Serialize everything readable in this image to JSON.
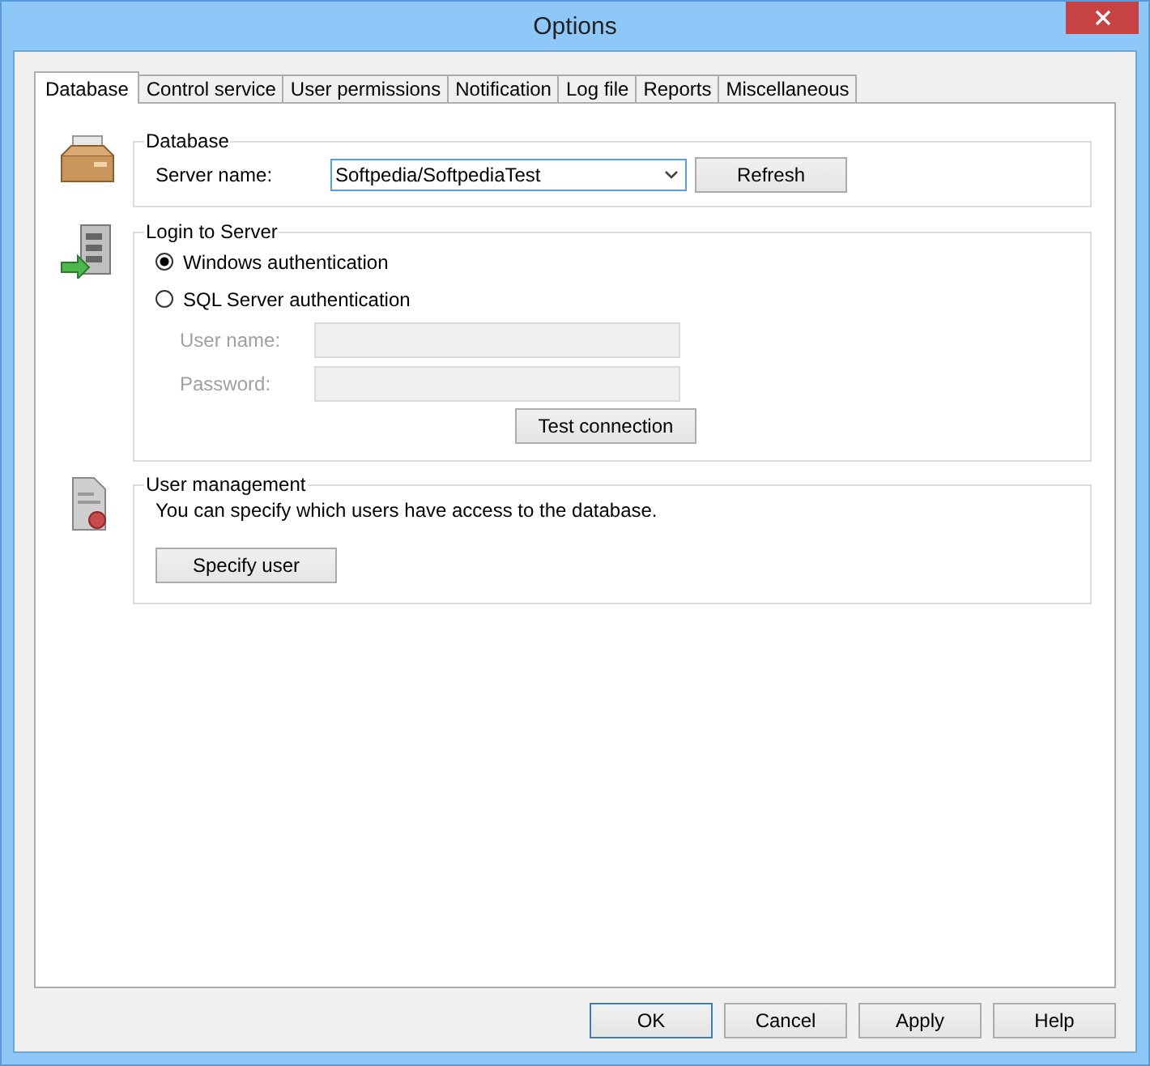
{
  "window": {
    "title": "Options"
  },
  "tabs": [
    {
      "label": "Database",
      "selected": true
    },
    {
      "label": "Control service",
      "selected": false
    },
    {
      "label": "User permissions",
      "selected": false
    },
    {
      "label": "Notification",
      "selected": false
    },
    {
      "label": "Log file",
      "selected": false
    },
    {
      "label": "Reports",
      "selected": false
    },
    {
      "label": "Miscellaneous",
      "selected": false
    }
  ],
  "database": {
    "title": "Database",
    "server_label": "Server name:",
    "server_value": "Softpedia/SoftpediaTest",
    "refresh": "Refresh"
  },
  "login": {
    "title": "Login to Server",
    "options": [
      {
        "label": "Windows authentication",
        "selected": true
      },
      {
        "label": "SQL Server authentication",
        "selected": false
      }
    ],
    "fields": [
      {
        "label": "User name:",
        "disabled": true
      },
      {
        "label": "Password:",
        "disabled": true
      }
    ],
    "test_button": "Test connection"
  },
  "user_management": {
    "title": "User management",
    "text": "You can specify which users have access to the database.",
    "button": "Specify user"
  },
  "buttons": [
    {
      "label": "OK",
      "default": true
    },
    {
      "label": "Cancel",
      "default": false
    },
    {
      "label": "Apply",
      "default": false
    },
    {
      "label": "Help",
      "default": false
    }
  ]
}
